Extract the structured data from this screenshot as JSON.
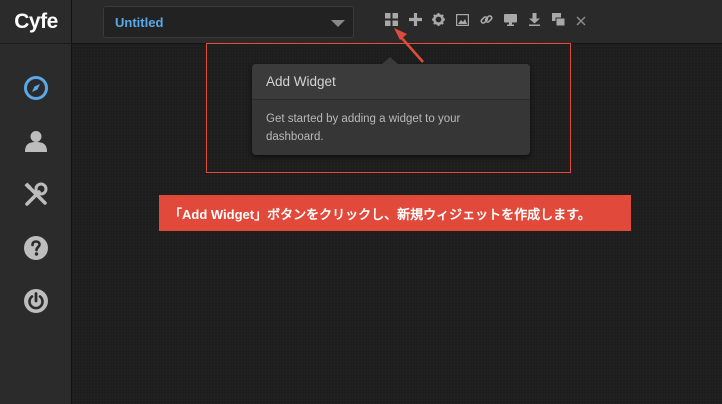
{
  "app": {
    "logo_text": "Cyfe"
  },
  "sidebar": {
    "items": [
      {
        "name": "dashboard",
        "icon": "compass-icon",
        "active": true
      },
      {
        "name": "account",
        "icon": "user-icon",
        "active": false
      },
      {
        "name": "tools",
        "icon": "tools-icon",
        "active": false
      },
      {
        "name": "help",
        "icon": "help-icon",
        "active": false
      },
      {
        "name": "logout",
        "icon": "power-icon",
        "active": false
      }
    ]
  },
  "toolbar": {
    "dashboard_select_value": "Untitled",
    "icons": [
      "grid-icon",
      "plus-icon",
      "gear-icon",
      "image-icon",
      "link-icon",
      "monitor-icon",
      "download-icon",
      "copy-icon",
      "close-icon"
    ]
  },
  "popover": {
    "title": "Add Widget",
    "body": "Get started by adding a widget to your dashboard."
  },
  "annotation": {
    "text": "「Add Widget」ボタンをクリックし、新規ウィジェットを作成します。",
    "color": "#e1493a"
  },
  "colors": {
    "accent_blue": "#5aa9e6",
    "sidebar_icon": "#bdbdbd",
    "highlight_red": "#e04c3c"
  }
}
